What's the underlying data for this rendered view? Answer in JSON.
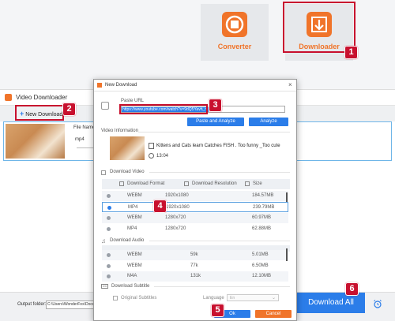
{
  "launcher": {
    "converter_label": "Converter",
    "downloader_label": "Downloader"
  },
  "badges": [
    "1",
    "2",
    "3",
    "4",
    "5",
    "6"
  ],
  "bg_window": {
    "title": "Video Downloader",
    "new_download_label": "New Download",
    "file_name_label": "File Name",
    "format_value": "mp4",
    "output_folder_label": "Output folder:",
    "output_folder_value": "C:\\Users\\WonderFox\\Docum",
    "download_all_label": "Download All"
  },
  "dialog": {
    "title": "New Download",
    "paste_url_label": "Paste URL",
    "url_value": "https://www.youtube.com/watch?v=9dQ5Yavh_rc",
    "paste_analyze_label": "Paste and Analyze",
    "analyze_label": "Analyze",
    "video_info_label": "Video Information",
    "video_title": "Kittens and Cats learn Catches FISH . Too funny _Too cute",
    "duration": "13:04",
    "download_video_label": "Download Video",
    "video_columns": [
      "Download Format",
      "Download Resolution",
      "Size"
    ],
    "video_rows": [
      {
        "format": "WEBM",
        "resolution": "1920x1080",
        "size": "184.57MB"
      },
      {
        "format": "MP4",
        "resolution": "1920x1080",
        "size": "239.79MB"
      },
      {
        "format": "WEBM",
        "resolution": "1280x720",
        "size": "60.97MB"
      },
      {
        "format": "MP4",
        "resolution": "1280x720",
        "size": "62.88MB"
      }
    ],
    "download_audio_label": "Download Audio",
    "audio_rows": [
      {
        "format": "WEBM",
        "bitrate": "59k",
        "size": "5.01MB"
      },
      {
        "format": "WEBM",
        "bitrate": "77k",
        "size": "6.50MB"
      },
      {
        "format": "M4A",
        "bitrate": "131k",
        "size": "12.10MB"
      }
    ],
    "download_subtitle_label": "Download Subtitle",
    "original_subtitles_label": "Original Subtitles",
    "language_label": "Language",
    "language_value": "En",
    "ok_label": "Ok",
    "cancel_label": "Cancel"
  },
  "colors": {
    "accent": "#2b7de9",
    "brand_orange": "#f0742a",
    "marker_red": "#c8102e"
  }
}
